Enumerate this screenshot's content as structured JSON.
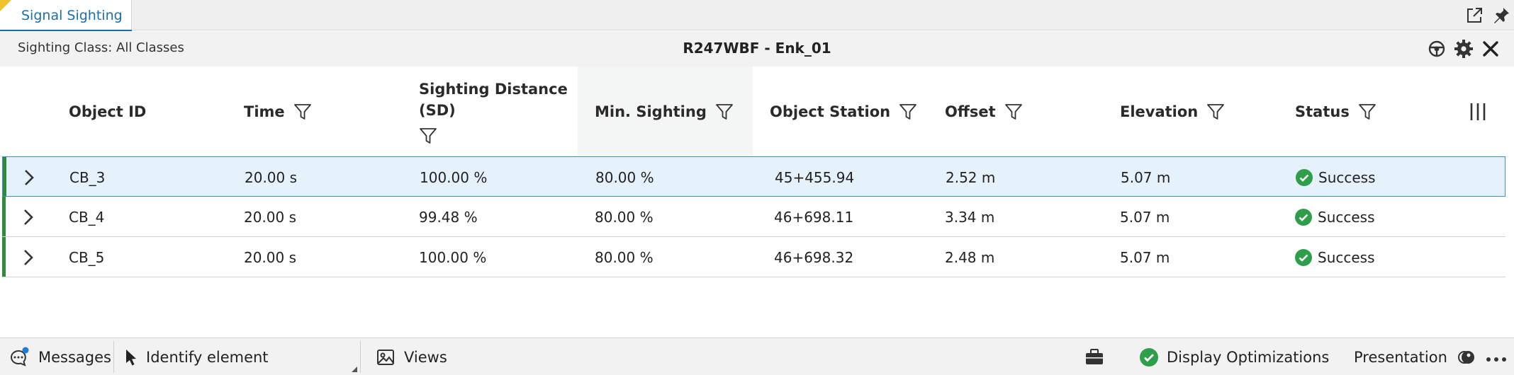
{
  "tab": {
    "label": "Signal Sighting"
  },
  "header": {
    "sighting_class": "Sighting Class: All Classes",
    "title": "R247WBF - Enk_01"
  },
  "table": {
    "columns": [
      {
        "label": "Object ID"
      },
      {
        "label": "Time"
      },
      {
        "label": "Sighting Distance (SD)"
      },
      {
        "label": "Min. Sighting"
      },
      {
        "label": "Object Station"
      },
      {
        "label": "Offset"
      },
      {
        "label": "Elevation"
      },
      {
        "label": "Status"
      }
    ],
    "rows": [
      {
        "id": "CB_3",
        "time": "20.00 s",
        "sd": "100.00 %",
        "min": "80.00 %",
        "station": "45+455.94",
        "offset": "2.52 m",
        "elevation": "5.07 m",
        "status": "Success"
      },
      {
        "id": "CB_4",
        "time": "20.00 s",
        "sd": "99.48 %",
        "min": "80.00 %",
        "station": "46+698.11",
        "offset": "3.34 m",
        "elevation": "5.07 m",
        "status": "Success"
      },
      {
        "id": "CB_5",
        "time": "20.00 s",
        "sd": "100.00 %",
        "min": "80.00 %",
        "station": "46+698.32",
        "offset": "2.48 m",
        "elevation": "5.07 m",
        "status": "Success"
      }
    ]
  },
  "statusbar": {
    "messages": "Messages",
    "identify": "Identify element",
    "views": "Views",
    "display_optimizations": "Display Optimizations",
    "presentation": "Presentation"
  },
  "colors": {
    "accent": "#1a6fae",
    "success": "#2e9e4a",
    "row_accent": "#2e8b3b",
    "selected_row": "#e5f2fb"
  },
  "icons": [
    "expand-icon",
    "pin-icon",
    "steering-wheel-icon",
    "gear-icon",
    "close-icon",
    "filter-icon",
    "column-chooser-icon",
    "chevron-right-icon",
    "check-circle-icon",
    "chat-icon",
    "pointer-icon",
    "views-icon",
    "briefcase-icon",
    "presentation-icon",
    "more-icon"
  ]
}
